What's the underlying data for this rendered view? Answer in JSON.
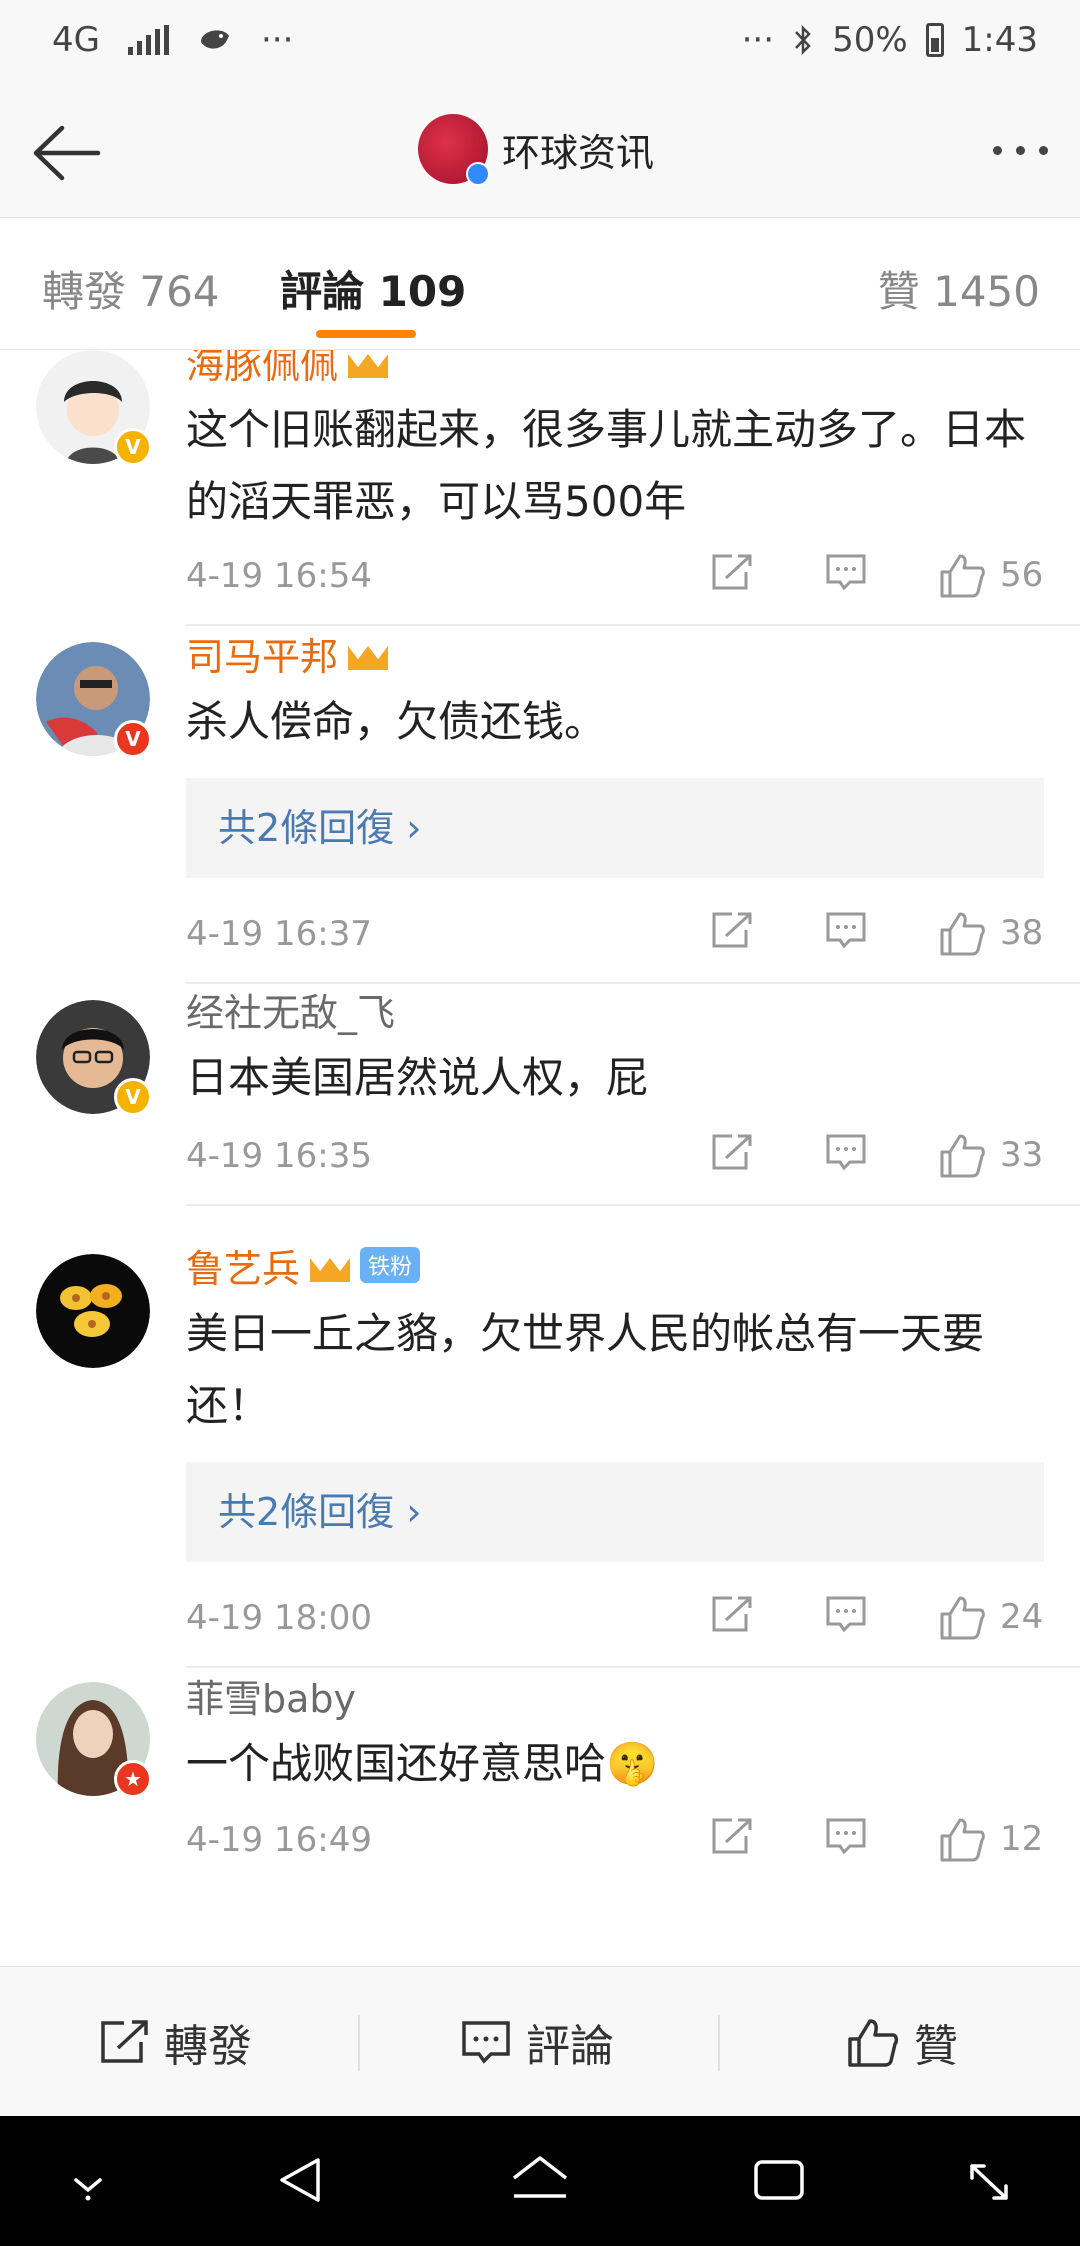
{
  "status_bar": {
    "network": "4G",
    "left_more": "···",
    "right_more": "···",
    "battery": "50%",
    "time": "1:43"
  },
  "nav": {
    "title": "环球资讯",
    "logo_icon": "brand-avatar",
    "back_icon": "back-arrow-icon",
    "more_icon": "more-icon"
  },
  "tabs": {
    "reposts": "轉發 764",
    "comments": "評論 109",
    "likes": "贊 1450",
    "active_color": "#ff8200"
  },
  "comments": [
    {
      "name": "海豚佩佩",
      "name_color": "orange",
      "crown": true,
      "fan_badge": "",
      "badge": "gold",
      "text": "这个旧账翻起来，很多事儿就主动多了。日本的滔天罪恶，可以骂500年",
      "replies": "",
      "time": "4-19 16:54",
      "likes": "56"
    },
    {
      "name": "司马平邦",
      "name_color": "orange",
      "crown": true,
      "fan_badge": "",
      "badge": "red",
      "text": "杀人偿命，欠债还钱。",
      "replies": "共2條回復 ›",
      "time": "4-19 16:37",
      "likes": "38"
    },
    {
      "name": "经社无敌_飞",
      "name_color": "gray",
      "crown": false,
      "fan_badge": "",
      "badge": "gold",
      "text": "日本美国居然说人权，屁",
      "replies": "",
      "time": "4-19 16:35",
      "likes": "33"
    },
    {
      "name": "鲁艺兵",
      "name_color": "orange",
      "crown": true,
      "fan_badge": "铁粉",
      "badge": "",
      "text": "美日一丘之貉，欠世界人民的帐总有一天要还！",
      "replies": "共2條回復 ›",
      "time": "4-19 18:00",
      "likes": "24"
    },
    {
      "name": "菲雪baby",
      "name_color": "gray",
      "crown": false,
      "fan_badge": "",
      "badge": "red",
      "text": "一个战败国还好意思哈🤫",
      "replies": "",
      "time": "4-19 16:49",
      "likes": "12"
    }
  ],
  "bottom_bar": {
    "repost": "轉發",
    "comment": "評論",
    "like": "贊"
  }
}
